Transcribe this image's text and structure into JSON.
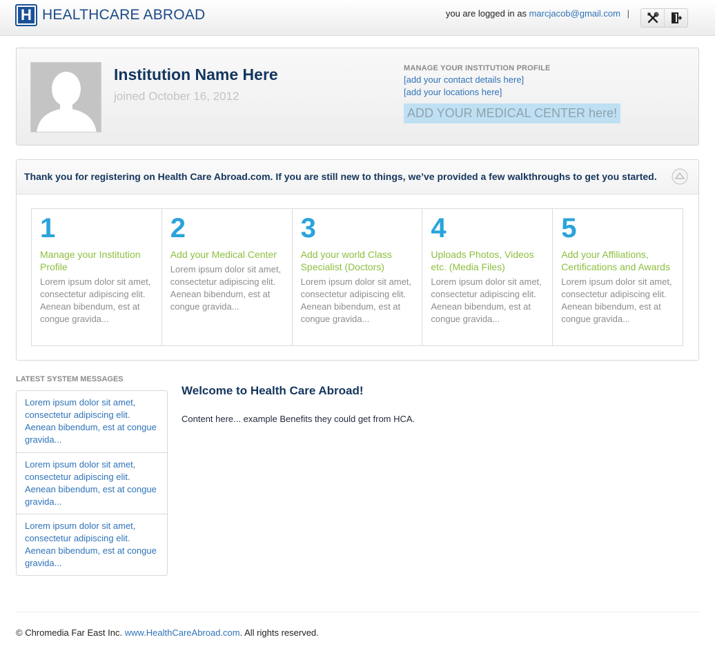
{
  "header": {
    "logo_text": "HEALTHCARE ABROAD",
    "logo_letter": "H",
    "logged_in_prefix": "you are logged in as",
    "user_email": "marcjacob@gmail.com",
    "separator": "|",
    "icons": [
      "tools-icon",
      "logout-icon"
    ]
  },
  "profile": {
    "name": "Institution Name Here",
    "joined": "joined October 16, 2012",
    "manage_title": "MANAGE YOUR INSTITUTION PROFILE",
    "links": [
      "[add your contact details here]",
      "[add your locations here]"
    ],
    "add_center": "ADD YOUR MEDICAL CENTER here!"
  },
  "walkthrough": {
    "message": "Thank you for registering on Health Care Abroad.com. If you are still new to things, we’ve provided a few walkthroughs to get you started.",
    "steps": [
      {
        "num": "1",
        "title": "Manage your Institution Profile",
        "desc": "Lorem ipsum dolor sit amet, consectetur adipiscing elit. Aenean bibendum, est at congue gravida..."
      },
      {
        "num": "2",
        "title": "Add your Medical Center",
        "desc": "Lorem ipsum dolor sit amet, consectetur adipiscing elit. Aenean bibendum, est at congue gravida..."
      },
      {
        "num": "3",
        "title": "Add your world Class Specialist (Doctors)",
        "desc": "Lorem ipsum dolor sit amet, consectetur adipiscing elit. Aenean bibendum, est at congue gravida..."
      },
      {
        "num": "4",
        "title": "Uploads Photos, Videos etc. (Media Files)",
        "desc": "Lorem ipsum dolor sit amet, consectetur adipiscing elit. Aenean bibendum, est at congue gravida..."
      },
      {
        "num": "5",
        "title": "Add your Affiliations, Certifications and Awards",
        "desc": "Lorem ipsum dolor sit amet, consectetur adipiscing elit. Aenean bibendum, est at congue gravida..."
      }
    ]
  },
  "messages": {
    "title": "LATEST SYSTEM MESSAGES",
    "items": [
      "Lorem ipsum dolor sit amet, consectetur adipiscing elit. Aenean bibendum, est at congue gravida...",
      "Lorem ipsum dolor sit amet, consectetur adipiscing elit. Aenean bibendum, est at congue gravida...",
      "Lorem ipsum dolor sit amet, consectetur adipiscing elit. Aenean bibendum, est at congue gravida..."
    ]
  },
  "welcome": {
    "title": "Welcome to Health Care Abroad!",
    "body": "Content here... example Benefits they could get from HCA."
  },
  "footer": {
    "prefix": "© Chromedia Far East Inc.",
    "link": "www.HealthCareAbroad.com",
    "suffix": ". All rights reserved."
  },
  "colors": {
    "brand_blue": "#1a5196",
    "link_blue": "#2f73b8",
    "step_number": "#2aa3db",
    "step_title": "#8cbf3f",
    "highlight_bg": "#bfe0f3"
  }
}
